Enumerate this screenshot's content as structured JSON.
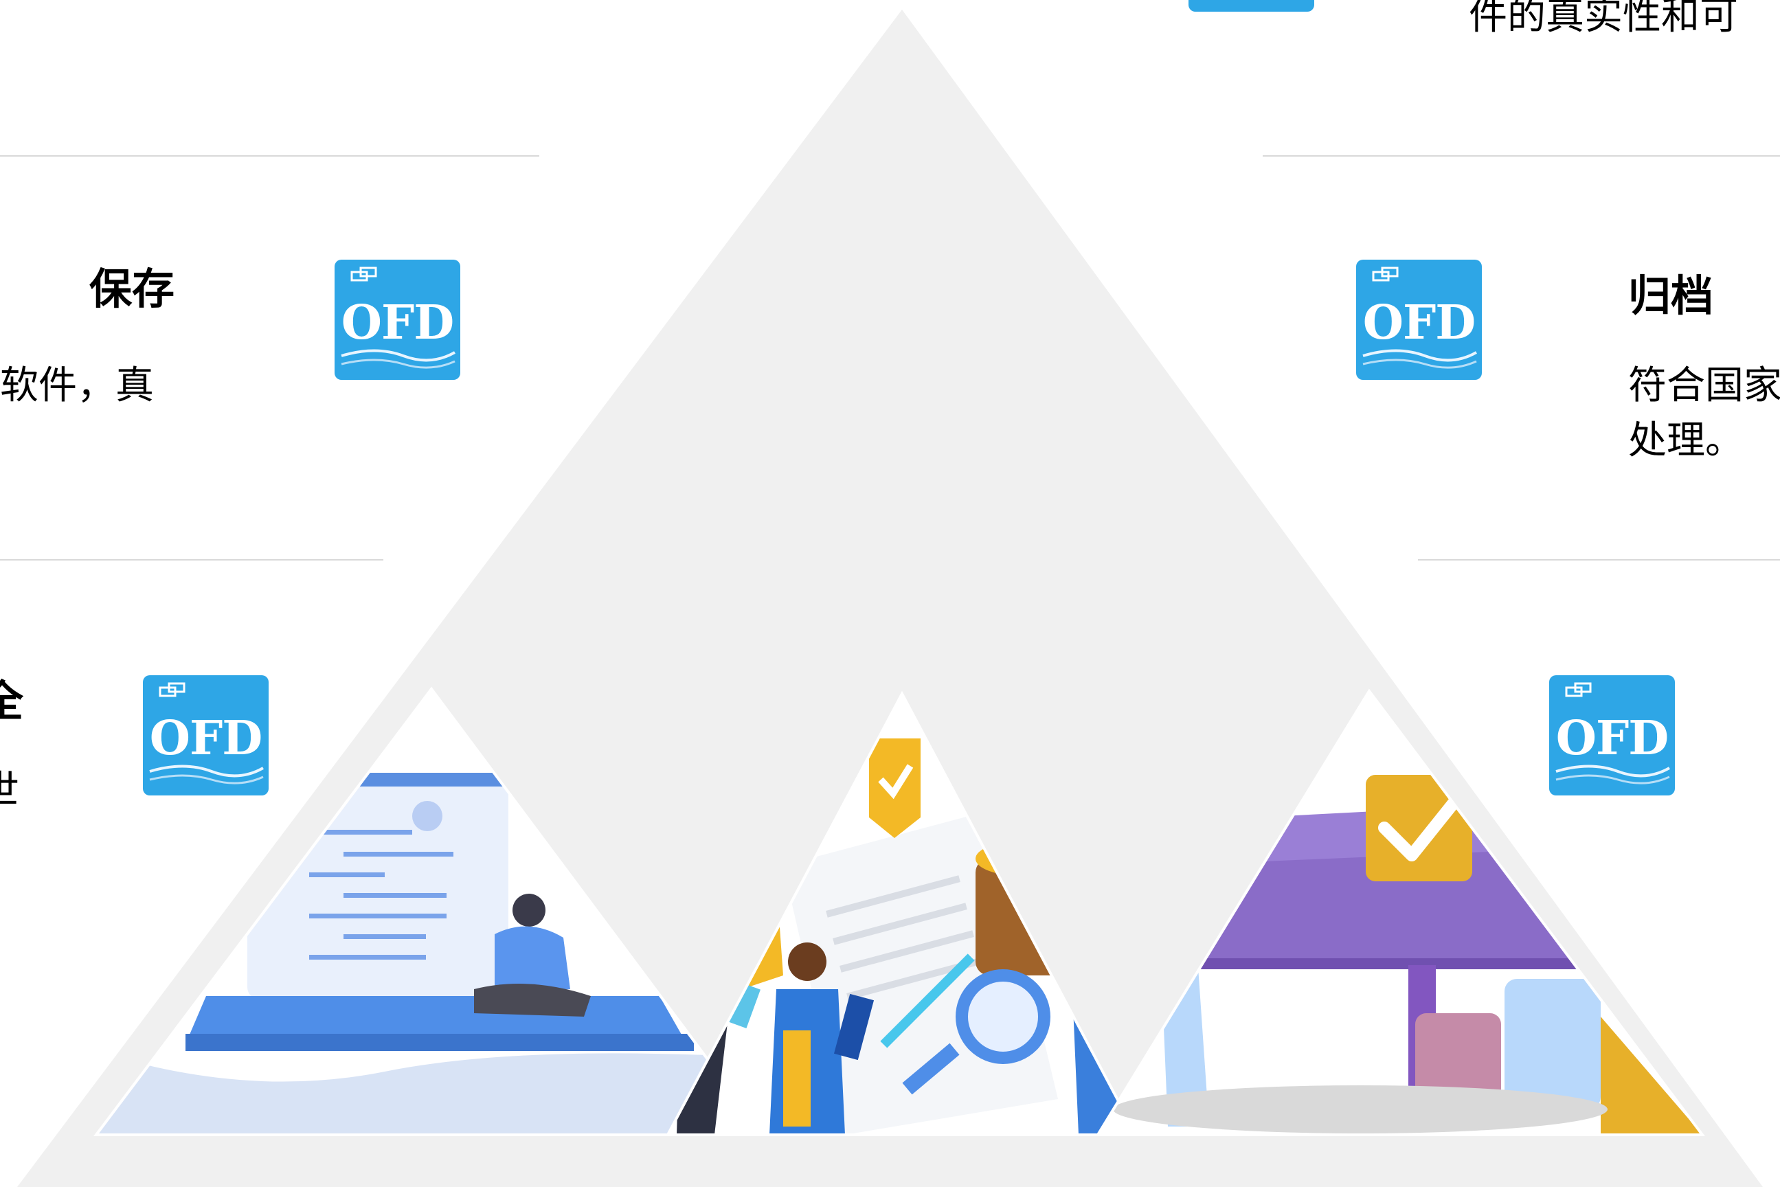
{
  "sections": {
    "save": {
      "title": "保存",
      "body": "软件，真"
    },
    "archive": {
      "title": "归档",
      "body_line1": "符合国家",
      "body_line2": "处理。"
    },
    "safety": {
      "title": "全",
      "body": "世"
    },
    "top_right_text": "件的真实性和可"
  },
  "icon": {
    "label": "OFD",
    "name": "ofd-icon"
  },
  "colors": {
    "ofd_blue": "#2ea6e6",
    "triangle_gray": "#f0f0f0",
    "divider": "#d9d9d9",
    "illus_blue": "#4f8ee8",
    "illus_purple": "#8a6cc8",
    "illus_yellow": "#f3b926"
  }
}
